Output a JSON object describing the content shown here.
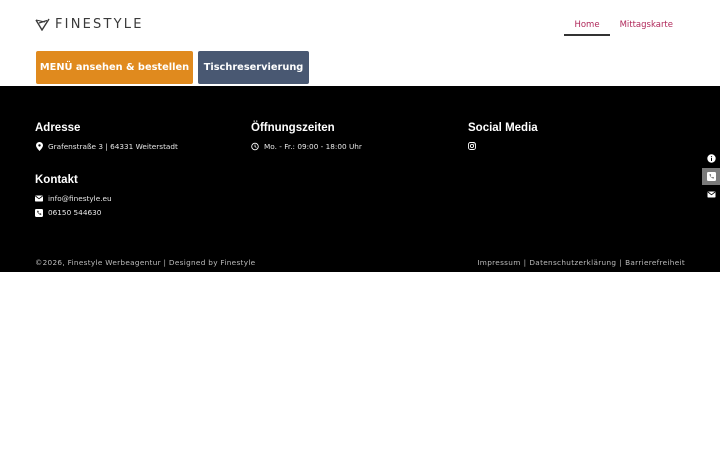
{
  "brand": {
    "name": "FINESTYLE"
  },
  "nav": {
    "items": [
      {
        "label": "Home"
      },
      {
        "label": "Mittagskarte"
      }
    ]
  },
  "buttons": {
    "menu": "MENÜ ansehen & bestellen",
    "reservation": "Tischreservierung"
  },
  "footer": {
    "address": {
      "title": "Adresse",
      "text": "Grafenstraße 3 | 64331 Weiterstadt"
    },
    "hours": {
      "title": "Öffnungszeiten",
      "text": "Mo. - Fr.: 09:00 - 18:00 Uhr"
    },
    "social": {
      "title": "Social Media",
      "icon": "instagram-icon"
    },
    "contact": {
      "title": "Kontakt",
      "email": "info@finestyle.eu",
      "phone": "06150 544630"
    },
    "copyright": "©2026, Finestyle Werbeagentur | Designed by Finestyle",
    "legal": [
      "Impressum",
      "Datenschutzerklärung",
      "Barrierefreiheit"
    ]
  },
  "colors": {
    "nav_link": "#b0285a",
    "menu_button": "#e08a1e",
    "reservation_button": "#495872",
    "footer_bg": "#000000"
  }
}
